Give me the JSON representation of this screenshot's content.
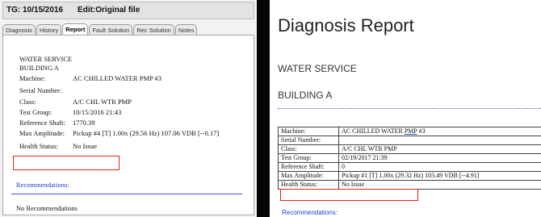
{
  "left": {
    "titlebar": {
      "tg": "TG: 10/15/2016",
      "edit": "Edit:Original file"
    },
    "tabs": [
      {
        "label": "Diagnosis"
      },
      {
        "label": "History"
      },
      {
        "label": "Report"
      },
      {
        "label": "Fault Solution"
      },
      {
        "label": "Rec Solution"
      },
      {
        "label": "Notes"
      }
    ],
    "report": {
      "service": "WATER SERVICE",
      "building": "BUILDING A",
      "machine_label": "Machine:",
      "machine_value": "AC CHILLED WATER PMP #3",
      "serial_label": "Serial Number:",
      "class_label": "Class:",
      "class_value": "A/C CHL WTR PMP",
      "testgroup_label": "Test Group:",
      "testgroup_value": "10/15/2016 21:43",
      "refshaft_label": "Reference Shaft:",
      "refshaft_value": "1770.39",
      "maxamp_label": "Max Amplitude:",
      "maxamp_value": "Pickup #4 [T] 1.00x (29.56 Hz) 107.06 VDB [--0.17]",
      "health_label": "Health Status:",
      "health_value": "No Issue",
      "recommendations_label": "Recommendations:",
      "no_recommendations": "No Recommendations"
    }
  },
  "right": {
    "title": "Diagnosis Report",
    "service": "WATER SERVICE",
    "building": "BUILDING A",
    "rows": [
      {
        "label": "Machine:",
        "value_a": "AC CHILLED WATER ",
        "value_b": "PMP",
        "value_c": " #3"
      },
      {
        "label": "Serial Number:",
        "value": ""
      },
      {
        "label": "Class:",
        "value": "A/C CHL WTR PMP"
      },
      {
        "label": "Test Group:",
        "value": "02/19/2017 21:39"
      },
      {
        "label": "Reference Shaft:",
        "value": "0"
      },
      {
        "label": "Max Amplitude:",
        "value": "Pickup #1 [T] 1.00x (29.32 Hz) 103.49 VDB [--4.91]"
      },
      {
        "label": "Health Status:",
        "value": "No Issue"
      }
    ],
    "recommendations_label": "Recommendations:"
  },
  "colors": {
    "highlight": "#e0211c",
    "link_blue": "#1d3fc7",
    "divider": "#050505"
  }
}
